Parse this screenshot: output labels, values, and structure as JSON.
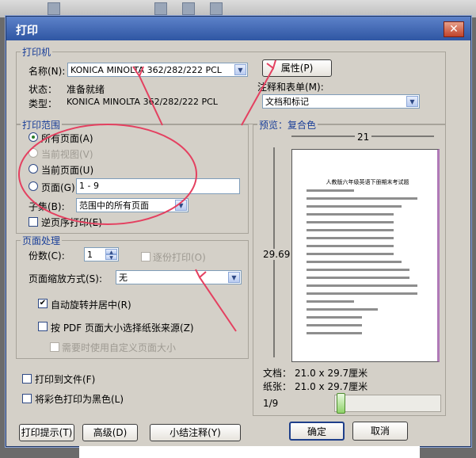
{
  "dialog": {
    "title": "打印"
  },
  "printer": {
    "group_label": "打印机",
    "name_label": "名称(N):",
    "name_value": "KONICA MINOLTA 362/282/222 PCL",
    "status_label": "状态：",
    "status_value": "准备就绪",
    "type_label": "类型：",
    "type_value": "KONICA MINOLTA 362/282/222 PCL",
    "properties_button": "属性(P)",
    "comments_label": "注释和表单(M):",
    "comments_value": "文档和标记"
  },
  "print_range": {
    "group_label": "打印范围",
    "all_pages": "所有页面(A)",
    "current_view": "当前视图(V)",
    "current_page": "当前页面(U)",
    "pages": "页面(G)",
    "pages_value": "1 - 9",
    "subset_label": "子集(B):",
    "subset_value": "范围中的所有页面",
    "reverse": "逆页序打印(E)"
  },
  "page_handling": {
    "group_label": "页面处理",
    "copies_label": "份数(C):",
    "copies_value": "1",
    "collate": "逐份打印(O)",
    "scaling_label": "页面缩放方式(S):",
    "scaling_value": "无",
    "auto_rotate": "自动旋转并居中(R)",
    "choose_source": "按 PDF 页面大小选择纸张来源(Z)",
    "custom_size": "需要时使用自定义页面大小"
  },
  "options": {
    "print_to_file": "打印到文件(F)",
    "grayscale": "将彩色打印为黑色(L)"
  },
  "preview": {
    "label": "预览：复合色",
    "width": "21",
    "height": "29.69",
    "doc_title": "人教版六年级英语下册期末考试题",
    "doc_size_label": "文档：",
    "doc_size_value": "21.0 x 29.7厘米",
    "paper_size_label": "纸张：",
    "paper_size_value": "21.0 x 29.7厘米",
    "page_indicator": "1/9"
  },
  "buttons": {
    "tips": "打印提示(T)",
    "advanced": "高级(D)",
    "summarize": "小结注释(Y)",
    "ok": "确定",
    "cancel": "取消"
  },
  "colors": {
    "group_label": "#1a3f99",
    "annotation": "#e44060",
    "titlebar": "#2f56a3"
  }
}
